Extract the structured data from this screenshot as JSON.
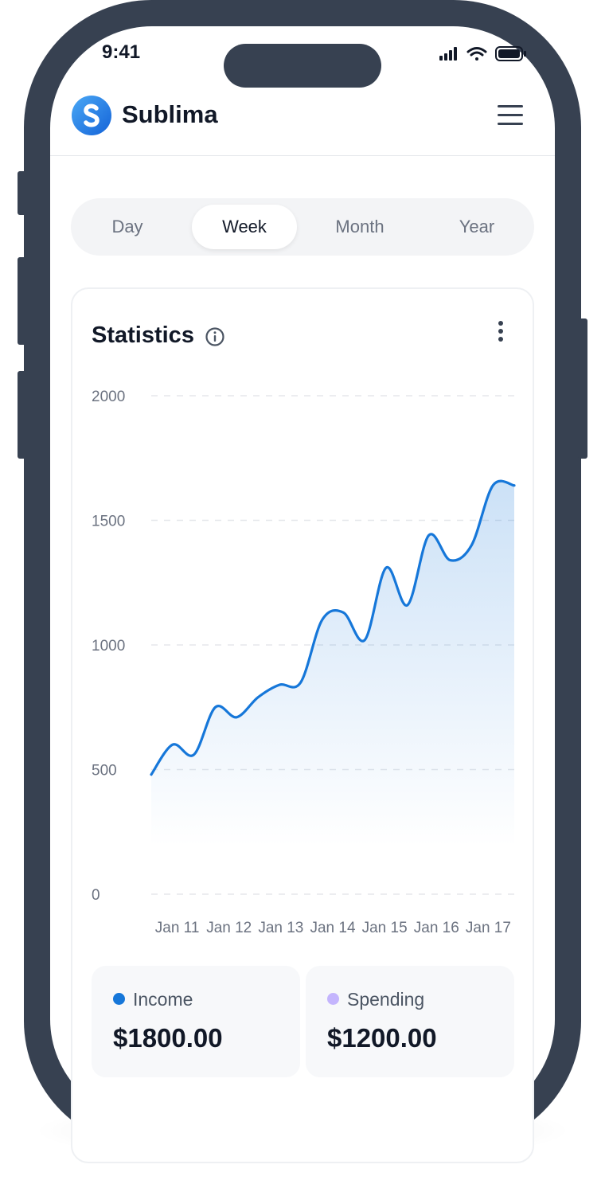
{
  "status_bar": {
    "time": "9:41"
  },
  "header": {
    "app_name": "Sublima"
  },
  "tabs": [
    {
      "label": "Day",
      "active": false
    },
    {
      "label": "Week",
      "active": true
    },
    {
      "label": "Month",
      "active": false
    },
    {
      "label": "Year",
      "active": false
    }
  ],
  "statistics": {
    "title": "Statistics"
  },
  "chart_data": {
    "type": "area",
    "x": [
      "Jan 11",
      "Jan 12",
      "Jan 13",
      "Jan 14",
      "Jan 15",
      "Jan 16",
      "Jan 17"
    ],
    "y_ticks": [
      "2000",
      "1500",
      "1000",
      "500",
      "0"
    ],
    "ylim": [
      0,
      2000
    ],
    "grid": true,
    "line_color": "#1677d9",
    "series": [
      {
        "values": [
          480,
          600,
          560,
          750,
          710,
          790,
          840,
          850,
          1100,
          1130,
          1020,
          1310,
          1160,
          1440,
          1340,
          1400,
          1640,
          1640
        ]
      }
    ]
  },
  "legend": [
    {
      "label": "Income",
      "value": "$1800.00",
      "color": "#1677d9"
    },
    {
      "label": "Spending",
      "value": "$1200.00",
      "color": "#c4b5fd"
    }
  ]
}
